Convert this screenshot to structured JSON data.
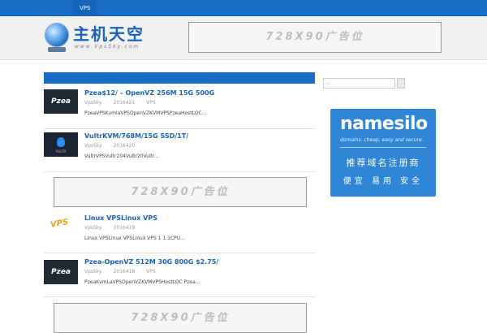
{
  "nav": {
    "items": [
      {
        "label": "VPS"
      }
    ]
  },
  "header": {
    "logo_title": "主机天空",
    "logo_url": "www.VpsSky.com",
    "ad_text": "728X90广告位"
  },
  "posts": [
    {
      "title": "Pzea$12/ – OpenVZ 256M 15G 500G",
      "author": "VpsSky",
      "date": "2016421",
      "category": "VPS",
      "excerpt": "PzeaVPSKvmlaVPSOpenVZKVMVPSPzeaHostLOC...",
      "thumb": "Pzea"
    },
    {
      "title": "VultrKVM/768M/15G SSD/1T/",
      "author": "VpsSky",
      "date": "2016420",
      "category": "",
      "excerpt": "VultrVPSVultr204Vultr20Vultr...",
      "thumb": "VULTR"
    },
    {
      "title": "Linux VPSLinux VPS",
      "author": "VpsSky",
      "date": "2016419",
      "category": "",
      "excerpt": "Linux VPSLinux VPSLinux VPS 1 1.1CPU...",
      "thumb": "VPS"
    },
    {
      "title": "Pzea-OpenVZ 512M 30G 800G $2.75/",
      "author": "VpsSky",
      "date": "2016418",
      "category": "VPS",
      "excerpt": "PzeaKvmLaVPSOpenVZKVMVPSHostLOC  Pzea...",
      "thumb": "Pzea"
    }
  ],
  "content_ads": [
    "728X90广告位",
    "728X90广告位"
  ],
  "sidebar": {
    "search_placeholder": "...",
    "namesilo": {
      "brand": "namesilo",
      "tagline": "domains. cheap, easy and secure.",
      "line1": "推荐域名注册商",
      "line2": "便宜 易用 安全"
    }
  },
  "colors": {
    "accent": "#1a6ec8",
    "link": "#1a62b8"
  }
}
